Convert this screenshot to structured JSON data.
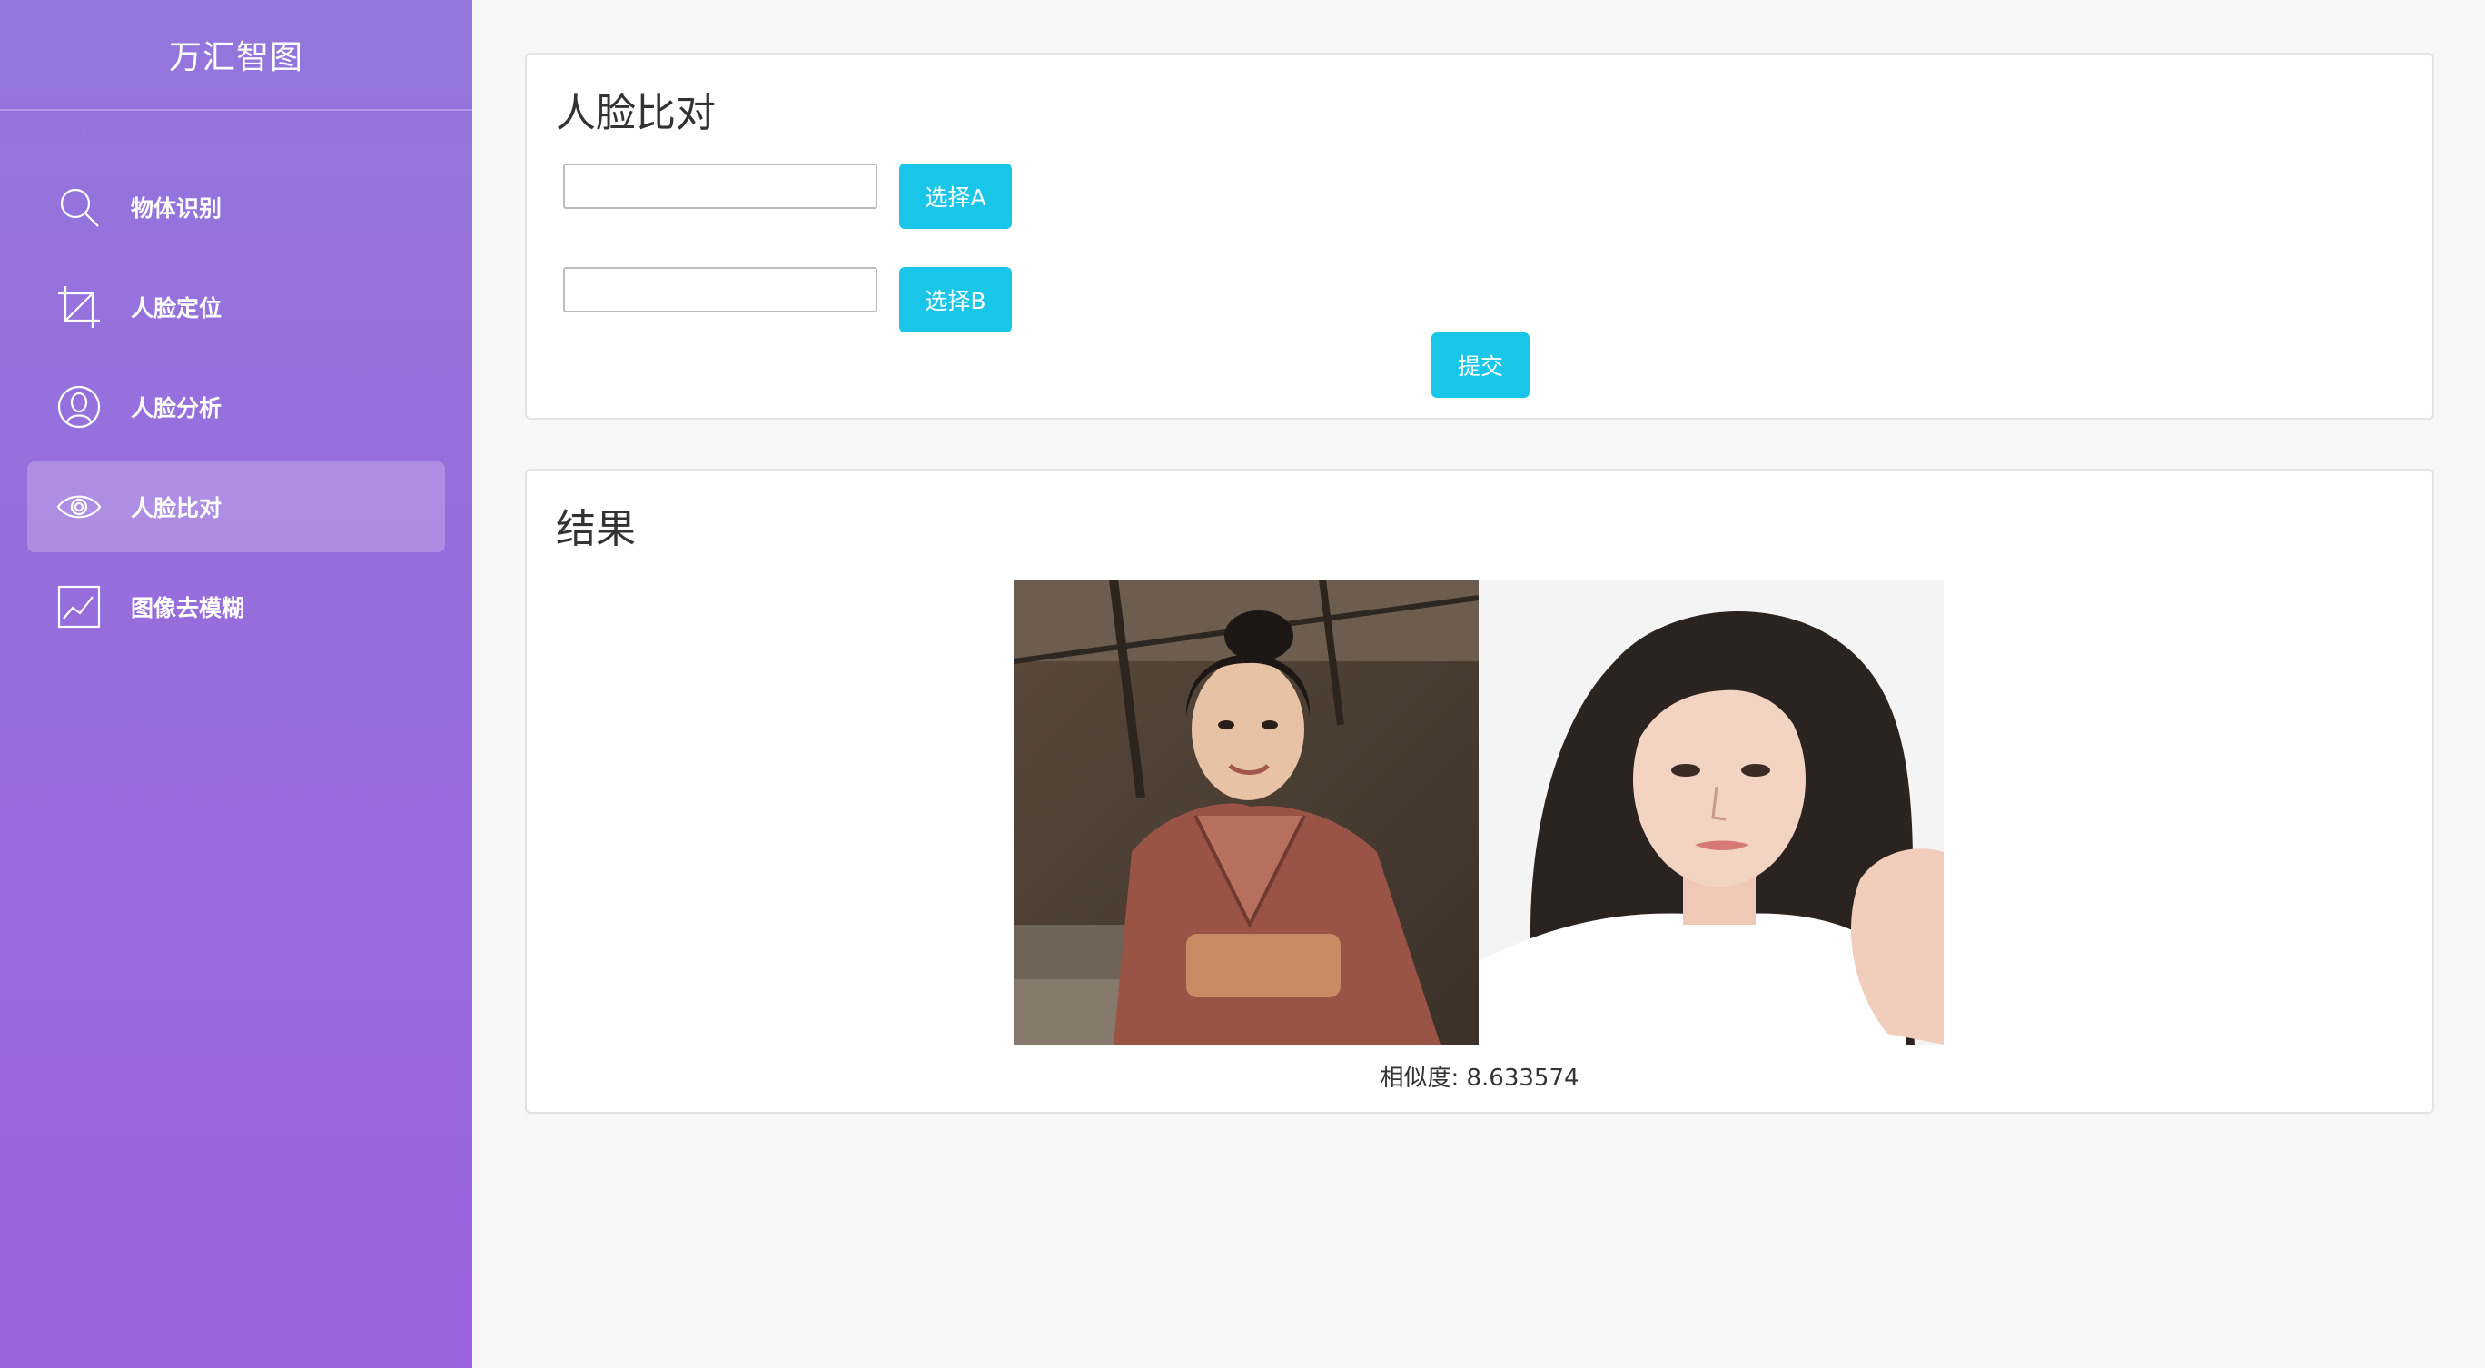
{
  "sidebar": {
    "brand": "万汇智图",
    "items": [
      {
        "label": "物体识别",
        "icon": "search-icon",
        "active": false
      },
      {
        "label": "人脸定位",
        "icon": "crop-icon",
        "active": false
      },
      {
        "label": "人脸分析",
        "icon": "user-circle-icon",
        "active": false
      },
      {
        "label": "人脸比对",
        "icon": "eye-icon",
        "active": true
      },
      {
        "label": "图像去模糊",
        "icon": "line-chart-icon",
        "active": false
      }
    ]
  },
  "compare": {
    "title": "人脸比对",
    "input_a_value": "",
    "input_b_value": "",
    "select_a_label": "选择A",
    "select_b_label": "选择B",
    "submit_label": "提交"
  },
  "result": {
    "title": "结果",
    "similarity_text": "相似度: 8.633574"
  },
  "colors": {
    "accent": "#1ac6e8",
    "sidebar_top": "#9476dc",
    "sidebar_bottom": "#9a62dd",
    "background": "#f7f7f7"
  }
}
